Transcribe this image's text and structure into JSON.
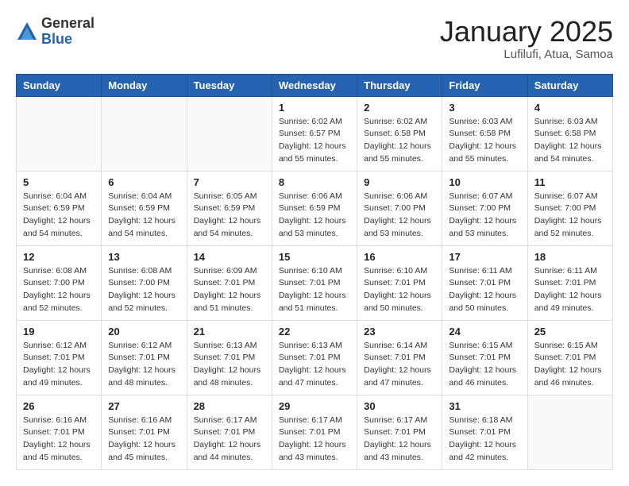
{
  "header": {
    "logo_general": "General",
    "logo_blue": "Blue",
    "month_title": "January 2025",
    "subtitle": "Lufilufi, Atua, Samoa"
  },
  "weekdays": [
    "Sunday",
    "Monday",
    "Tuesday",
    "Wednesday",
    "Thursday",
    "Friday",
    "Saturday"
  ],
  "weeks": [
    [
      {
        "day": "",
        "sunrise": "",
        "sunset": "",
        "daylight": ""
      },
      {
        "day": "",
        "sunrise": "",
        "sunset": "",
        "daylight": ""
      },
      {
        "day": "",
        "sunrise": "",
        "sunset": "",
        "daylight": ""
      },
      {
        "day": "1",
        "sunrise": "Sunrise: 6:02 AM",
        "sunset": "Sunset: 6:57 PM",
        "daylight": "Daylight: 12 hours and 55 minutes."
      },
      {
        "day": "2",
        "sunrise": "Sunrise: 6:02 AM",
        "sunset": "Sunset: 6:58 PM",
        "daylight": "Daylight: 12 hours and 55 minutes."
      },
      {
        "day": "3",
        "sunrise": "Sunrise: 6:03 AM",
        "sunset": "Sunset: 6:58 PM",
        "daylight": "Daylight: 12 hours and 55 minutes."
      },
      {
        "day": "4",
        "sunrise": "Sunrise: 6:03 AM",
        "sunset": "Sunset: 6:58 PM",
        "daylight": "Daylight: 12 hours and 54 minutes."
      }
    ],
    [
      {
        "day": "5",
        "sunrise": "Sunrise: 6:04 AM",
        "sunset": "Sunset: 6:59 PM",
        "daylight": "Daylight: 12 hours and 54 minutes."
      },
      {
        "day": "6",
        "sunrise": "Sunrise: 6:04 AM",
        "sunset": "Sunset: 6:59 PM",
        "daylight": "Daylight: 12 hours and 54 minutes."
      },
      {
        "day": "7",
        "sunrise": "Sunrise: 6:05 AM",
        "sunset": "Sunset: 6:59 PM",
        "daylight": "Daylight: 12 hours and 54 minutes."
      },
      {
        "day": "8",
        "sunrise": "Sunrise: 6:06 AM",
        "sunset": "Sunset: 6:59 PM",
        "daylight": "Daylight: 12 hours and 53 minutes."
      },
      {
        "day": "9",
        "sunrise": "Sunrise: 6:06 AM",
        "sunset": "Sunset: 7:00 PM",
        "daylight": "Daylight: 12 hours and 53 minutes."
      },
      {
        "day": "10",
        "sunrise": "Sunrise: 6:07 AM",
        "sunset": "Sunset: 7:00 PM",
        "daylight": "Daylight: 12 hours and 53 minutes."
      },
      {
        "day": "11",
        "sunrise": "Sunrise: 6:07 AM",
        "sunset": "Sunset: 7:00 PM",
        "daylight": "Daylight: 12 hours and 52 minutes."
      }
    ],
    [
      {
        "day": "12",
        "sunrise": "Sunrise: 6:08 AM",
        "sunset": "Sunset: 7:00 PM",
        "daylight": "Daylight: 12 hours and 52 minutes."
      },
      {
        "day": "13",
        "sunrise": "Sunrise: 6:08 AM",
        "sunset": "Sunset: 7:00 PM",
        "daylight": "Daylight: 12 hours and 52 minutes."
      },
      {
        "day": "14",
        "sunrise": "Sunrise: 6:09 AM",
        "sunset": "Sunset: 7:01 PM",
        "daylight": "Daylight: 12 hours and 51 minutes."
      },
      {
        "day": "15",
        "sunrise": "Sunrise: 6:10 AM",
        "sunset": "Sunset: 7:01 PM",
        "daylight": "Daylight: 12 hours and 51 minutes."
      },
      {
        "day": "16",
        "sunrise": "Sunrise: 6:10 AM",
        "sunset": "Sunset: 7:01 PM",
        "daylight": "Daylight: 12 hours and 50 minutes."
      },
      {
        "day": "17",
        "sunrise": "Sunrise: 6:11 AM",
        "sunset": "Sunset: 7:01 PM",
        "daylight": "Daylight: 12 hours and 50 minutes."
      },
      {
        "day": "18",
        "sunrise": "Sunrise: 6:11 AM",
        "sunset": "Sunset: 7:01 PM",
        "daylight": "Daylight: 12 hours and 49 minutes."
      }
    ],
    [
      {
        "day": "19",
        "sunrise": "Sunrise: 6:12 AM",
        "sunset": "Sunset: 7:01 PM",
        "daylight": "Daylight: 12 hours and 49 minutes."
      },
      {
        "day": "20",
        "sunrise": "Sunrise: 6:12 AM",
        "sunset": "Sunset: 7:01 PM",
        "daylight": "Daylight: 12 hours and 48 minutes."
      },
      {
        "day": "21",
        "sunrise": "Sunrise: 6:13 AM",
        "sunset": "Sunset: 7:01 PM",
        "daylight": "Daylight: 12 hours and 48 minutes."
      },
      {
        "day": "22",
        "sunrise": "Sunrise: 6:13 AM",
        "sunset": "Sunset: 7:01 PM",
        "daylight": "Daylight: 12 hours and 47 minutes."
      },
      {
        "day": "23",
        "sunrise": "Sunrise: 6:14 AM",
        "sunset": "Sunset: 7:01 PM",
        "daylight": "Daylight: 12 hours and 47 minutes."
      },
      {
        "day": "24",
        "sunrise": "Sunrise: 6:15 AM",
        "sunset": "Sunset: 7:01 PM",
        "daylight": "Daylight: 12 hours and 46 minutes."
      },
      {
        "day": "25",
        "sunrise": "Sunrise: 6:15 AM",
        "sunset": "Sunset: 7:01 PM",
        "daylight": "Daylight: 12 hours and 46 minutes."
      }
    ],
    [
      {
        "day": "26",
        "sunrise": "Sunrise: 6:16 AM",
        "sunset": "Sunset: 7:01 PM",
        "daylight": "Daylight: 12 hours and 45 minutes."
      },
      {
        "day": "27",
        "sunrise": "Sunrise: 6:16 AM",
        "sunset": "Sunset: 7:01 PM",
        "daylight": "Daylight: 12 hours and 45 minutes."
      },
      {
        "day": "28",
        "sunrise": "Sunrise: 6:17 AM",
        "sunset": "Sunset: 7:01 PM",
        "daylight": "Daylight: 12 hours and 44 minutes."
      },
      {
        "day": "29",
        "sunrise": "Sunrise: 6:17 AM",
        "sunset": "Sunset: 7:01 PM",
        "daylight": "Daylight: 12 hours and 43 minutes."
      },
      {
        "day": "30",
        "sunrise": "Sunrise: 6:17 AM",
        "sunset": "Sunset: 7:01 PM",
        "daylight": "Daylight: 12 hours and 43 minutes."
      },
      {
        "day": "31",
        "sunrise": "Sunrise: 6:18 AM",
        "sunset": "Sunset: 7:01 PM",
        "daylight": "Daylight: 12 hours and 42 minutes."
      },
      {
        "day": "",
        "sunrise": "",
        "sunset": "",
        "daylight": ""
      }
    ]
  ]
}
